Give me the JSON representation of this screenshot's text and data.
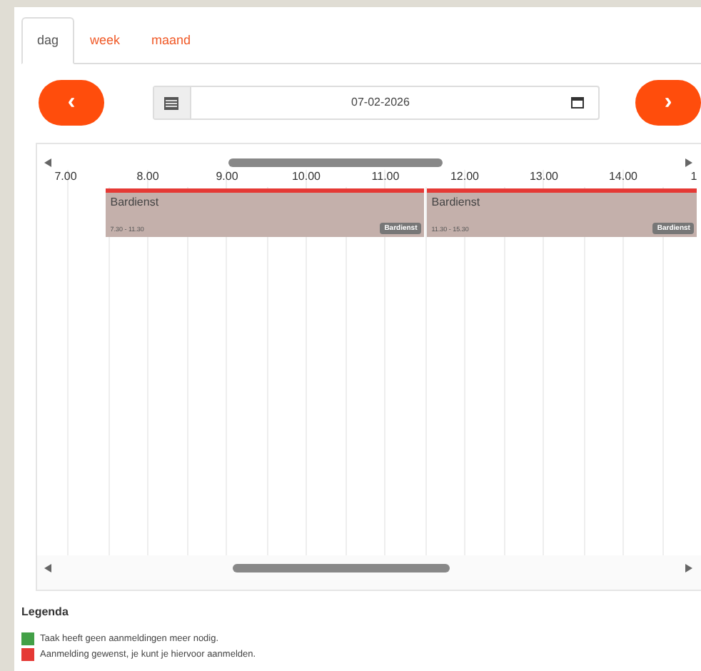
{
  "tabs": [
    {
      "label": "dag",
      "selected": true
    },
    {
      "label": "week",
      "selected": false
    },
    {
      "label": "maand",
      "selected": false
    }
  ],
  "nav": {
    "prev": "‹",
    "next": "›",
    "date": "07-02-2026"
  },
  "timeline": {
    "hours": [
      "7.00",
      "8.00",
      "9.00",
      "10.00",
      "11.00",
      "12.00",
      "13.00",
      "14.00",
      "1"
    ],
    "events": [
      {
        "title": "Bardienst",
        "time": "7.30 - 11.30",
        "badge": "Bardienst",
        "color": "#e53935"
      },
      {
        "title": "Bardienst",
        "time": "11.30 - 15.30",
        "badge": "Bardienst",
        "color": "#e53935"
      }
    ]
  },
  "legend": {
    "title": "Legenda",
    "items": [
      {
        "label": "Taak heeft geen aanmeldingen meer nodig.",
        "color": "#43a047"
      },
      {
        "label": "Aanmelding gewenst, je kunt je hiervoor aanmelden.",
        "color": "#e53935"
      }
    ]
  }
}
